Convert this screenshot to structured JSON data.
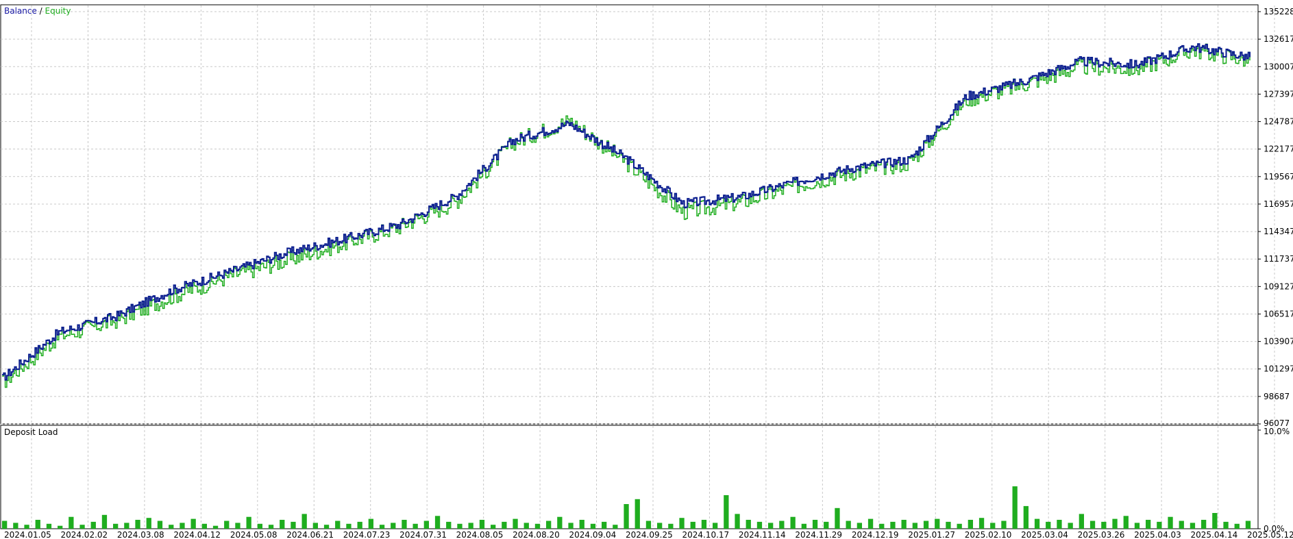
{
  "main_panel": {
    "legend": {
      "balance_label": "Balance",
      "separator": " / ",
      "equity_label": "Equity"
    },
    "y_ticks": [
      "135228",
      "132617",
      "130007",
      "127397",
      "124787",
      "122177",
      "119567",
      "116957",
      "114347",
      "111737",
      "109127",
      "106517",
      "103907",
      "101297",
      "98687",
      "96077"
    ]
  },
  "sub_panel": {
    "title": "Deposit Load",
    "y_ticks": [
      "10.0%",
      "0.0%"
    ]
  },
  "x_ticks": [
    "2024.01.05",
    "2024.02.02",
    "2024.03.08",
    "2024.04.12",
    "2024.05.08",
    "2024.06.21",
    "2024.07.23",
    "2024.07.31",
    "2024.08.05",
    "2024.08.20",
    "2024.09.04",
    "2024.09.25",
    "2024.10.17",
    "2024.11.14",
    "2024.11.29",
    "2024.12.19",
    "2025.01.27",
    "2025.02.10",
    "2025.03.04",
    "2025.03.26",
    "2025.04.03",
    "2025.04.14",
    "2025.05.12"
  ],
  "colors": {
    "balance": "#0a1d8f",
    "equity": "#1fad1f",
    "grid": "#c8c8c8",
    "frame": "#000000",
    "load": "#1fad1f",
    "legend_balance": "#1a1aa6",
    "legend_equity": "#1fad1f"
  },
  "chart_data": [
    {
      "type": "line",
      "title": "",
      "x": [
        "2024.01.05",
        "2024.02.02",
        "2024.03.08",
        "2024.04.12",
        "2024.05.08",
        "2024.06.21",
        "2024.07.23",
        "2024.07.31",
        "2024.08.05",
        "2024.08.20",
        "2024.09.04",
        "2024.09.25",
        "2024.10.17",
        "2024.11.14",
        "2024.11.29",
        "2024.12.19",
        "2025.01.27",
        "2025.02.10",
        "2025.03.04",
        "2025.03.26",
        "2025.04.03",
        "2025.04.14",
        "2025.05.12"
      ],
      "ylim": [
        96077,
        135228
      ],
      "grid": true,
      "legend": "top-left",
      "series": [
        {
          "name": "Balance",
          "values": [
            100400,
            104800,
            106300,
            108800,
            110500,
            112300,
            113600,
            115000,
            117700,
            123000,
            124600,
            121300,
            117000,
            117600,
            119100,
            120400,
            121200,
            127200,
            128600,
            130500,
            130200,
            131900,
            130900
          ]
        },
        {
          "name": "Equity",
          "values": [
            100000,
            104400,
            105900,
            108200,
            110100,
            111600,
            113200,
            114800,
            117200,
            122800,
            124900,
            120900,
            116200,
            117100,
            118700,
            120000,
            120900,
            126900,
            128300,
            130000,
            129800,
            131600,
            130600
          ]
        }
      ]
    },
    {
      "type": "bar",
      "title": "Deposit Load",
      "ylim": [
        0,
        10
      ],
      "unit": "%",
      "values": [
        0.8,
        0.6,
        0.4,
        0.9,
        0.5,
        0.3,
        1.2,
        0.4,
        0.7,
        1.4,
        0.5,
        0.6,
        0.9,
        1.1,
        0.8,
        0.4,
        0.6,
        1.0,
        0.5,
        0.3,
        0.8,
        0.6,
        1.2,
        0.5,
        0.4,
        0.9,
        0.7,
        1.5,
        0.6,
        0.4,
        0.8,
        0.5,
        0.7,
        1.0,
        0.4,
        0.6,
        0.9,
        0.5,
        0.8,
        1.3,
        0.7,
        0.5,
        0.6,
        0.9,
        0.4,
        0.7,
        1.0,
        0.6,
        0.5,
        0.8,
        1.2,
        0.6,
        0.9,
        0.5,
        0.7,
        0.4,
        2.5,
        3.0,
        0.8,
        0.6,
        0.5,
        1.1,
        0.7,
        0.9,
        0.6,
        3.4,
        1.5,
        0.9,
        0.7,
        0.6,
        0.8,
        1.2,
        0.5,
        0.9,
        0.7,
        2.1,
        0.8,
        0.6,
        1.0,
        0.5,
        0.7,
        0.9,
        0.6,
        0.8,
        1.0,
        0.7,
        0.5,
        0.9,
        1.1,
        0.6,
        0.8,
        4.3,
        2.3,
        1.0,
        0.7,
        0.9,
        0.6,
        1.5,
        0.8,
        0.7,
        1.0,
        1.3,
        0.6,
        0.9,
        0.7,
        1.2,
        0.8,
        0.6,
        0.9,
        1.6,
        0.7,
        0.5,
        0.8
      ]
    }
  ]
}
